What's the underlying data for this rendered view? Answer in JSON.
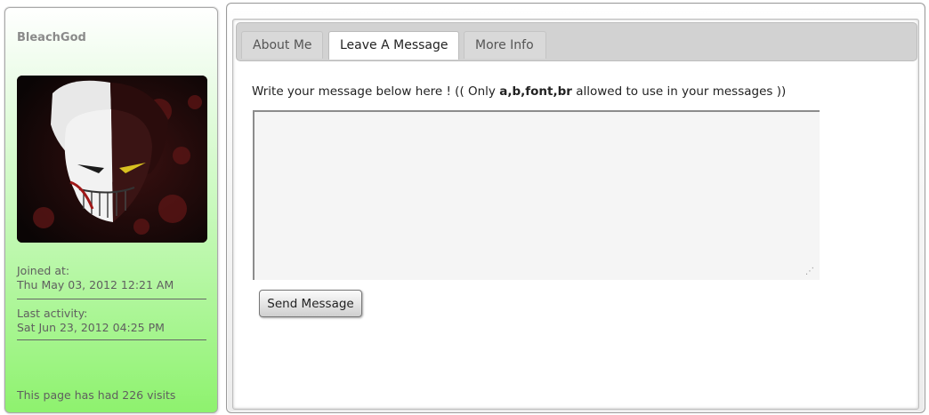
{
  "profile": {
    "username": "BleachGod",
    "joined_label": "Joined at:",
    "joined_value": "Thu May 03, 2012 12:21 AM",
    "activity_label": "Last activity:",
    "activity_value": "Sat Jun 23, 2012 04:25 PM",
    "visits_text": "This page has had 226 visits"
  },
  "tabs": [
    {
      "label": "About Me",
      "active": false
    },
    {
      "label": "Leave A Message",
      "active": true
    },
    {
      "label": "More Info",
      "active": false
    }
  ],
  "message": {
    "instruction_prefix": "Write your message below here ! (( Only ",
    "allowed_tags": "a,b,font,br",
    "instruction_suffix": " allowed to use in your messages ))",
    "value": "",
    "send_label": "Send Message"
  },
  "colors": {
    "profile_gradient_end": "#8ef26e",
    "tabbar_bg": "#d2d2d2",
    "active_tab_bg": "#ffffff"
  }
}
